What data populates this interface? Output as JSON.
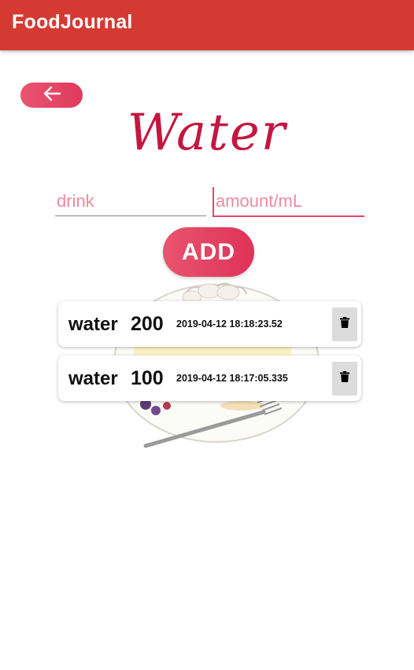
{
  "app_bar": {
    "title": "FoodJournal"
  },
  "page": {
    "heading": "Water"
  },
  "form": {
    "drink_placeholder": "drink",
    "drink_value": "",
    "amount_placeholder": "amount/mL",
    "amount_value": "",
    "add_label": "ADD"
  },
  "entries": [
    {
      "name": "water",
      "amount": "200",
      "timestamp": "2019-04-12 18:18:23.52"
    },
    {
      "name": "water",
      "amount": "100",
      "timestamp": "2019-04-12 18:17:05.335"
    }
  ],
  "icons": {
    "back": "arrow-left-icon",
    "delete": "trash-icon"
  },
  "colors": {
    "app_bar": "#d43a32",
    "accent": "#e03a5c",
    "heading": "#c4173f"
  }
}
